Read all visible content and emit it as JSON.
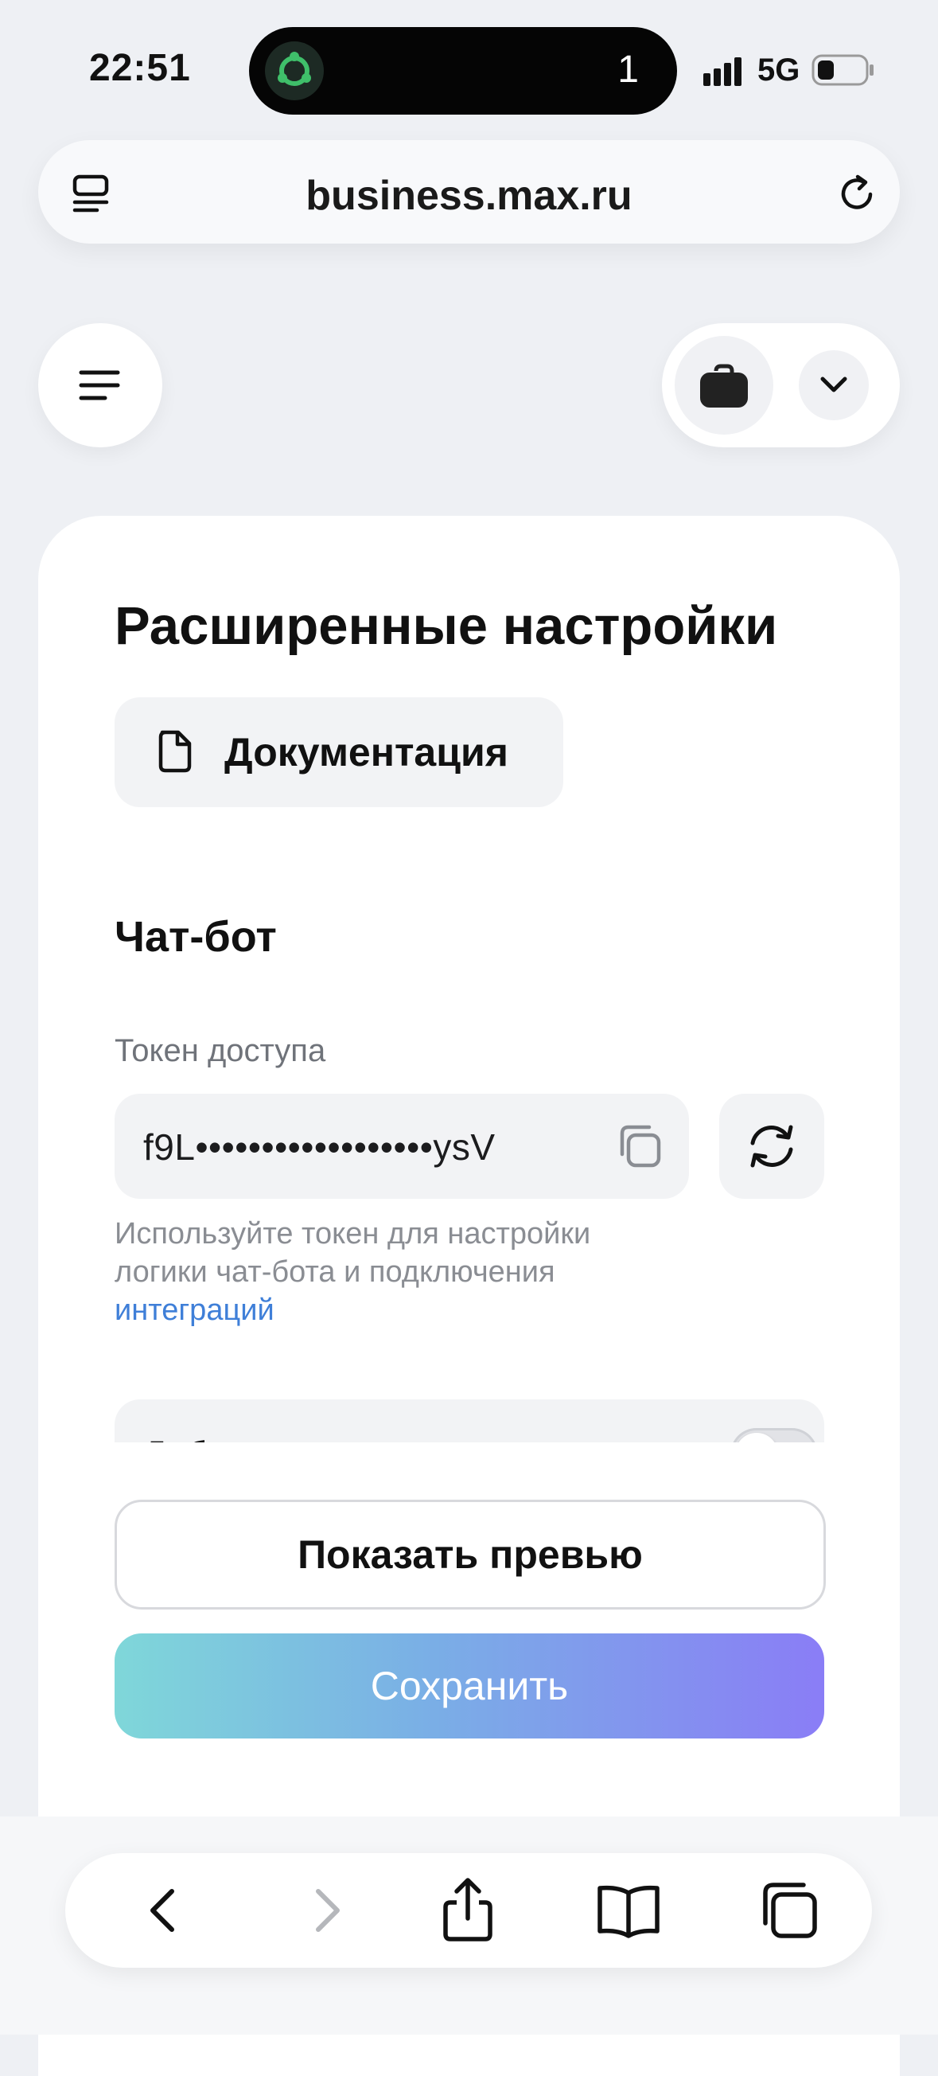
{
  "status_bar": {
    "time": "22:51",
    "island_count": "1",
    "network": "5G"
  },
  "browser": {
    "url": "business.max.ru"
  },
  "page": {
    "title": "Расширенные настройки",
    "doc_button": "Документация",
    "section_title": "Чат-бот",
    "token_label": "Токен доступа",
    "token_value": "f9L••••••••••••••••••ysV",
    "hint_text": "Используйте токен для настройки логики чат-бота и подключения",
    "hint_link": "интеграций",
    "setting_label": "Доб",
    "preview_button": "Показать превью",
    "save_button": "Сохранить"
  },
  "colors": {
    "accent_link": "#3f7fd8",
    "save_gradient_start": "#7fd7d9",
    "save_gradient_end": "#8a7df6"
  },
  "icons": [
    "reader-icon",
    "reload-icon",
    "menu-icon",
    "briefcase-icon",
    "chevron-down-icon",
    "document-icon",
    "copy-icon",
    "refresh-icon",
    "back-icon",
    "forward-icon",
    "share-icon",
    "bookmarks-icon",
    "tabs-icon"
  ]
}
